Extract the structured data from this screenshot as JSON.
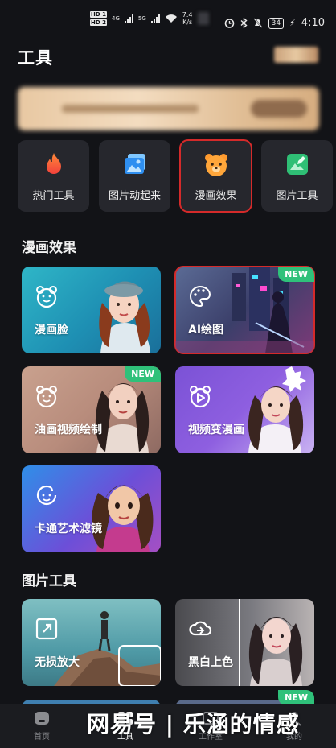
{
  "status_bar": {
    "hd1": "HD 1",
    "hd2": "HD 2",
    "net1": "4G",
    "net2": "5G",
    "speed": "7.4",
    "speed_unit": "K/s",
    "battery": "34",
    "time": "4:10"
  },
  "header": {
    "title": "工具"
  },
  "quick_tools": [
    {
      "label": "热门工具",
      "icon": "fire-icon"
    },
    {
      "label": "图片动起来",
      "icon": "image-gallery-icon"
    },
    {
      "label": "漫画效果",
      "icon": "bear-face-icon"
    },
    {
      "label": "图片工具",
      "icon": "image-edit-icon"
    }
  ],
  "comic_section": {
    "title": "漫画效果",
    "cards": [
      {
        "label": "漫画脸",
        "icon": "bear-icon",
        "badge": ""
      },
      {
        "label": "AI绘图",
        "icon": "palette-icon",
        "badge": "NEW"
      },
      {
        "label": "油画视频绘制",
        "icon": "bear-icon",
        "badge": "NEW"
      },
      {
        "label": "视频变漫画",
        "icon": "video-bear-icon",
        "badge": ""
      },
      {
        "label": "卡通艺术滤镜",
        "icon": "cartoon-face-icon",
        "badge": ""
      }
    ]
  },
  "image_tools_section": {
    "title": "图片工具",
    "cards": [
      {
        "label": "无损放大",
        "icon": "expand-icon",
        "badge": ""
      },
      {
        "label": "黑白上色",
        "icon": "color-cloud-icon",
        "badge": ""
      }
    ],
    "next_badge": "NEW"
  },
  "bottom_nav": [
    {
      "label": "首页",
      "icon": "home-icon"
    },
    {
      "label": "工具",
      "icon": "tools-icon"
    },
    {
      "label": "工作室",
      "icon": "studio-icon"
    },
    {
      "label": "我的",
      "icon": "profile-icon"
    }
  ],
  "watermark": "网易号 | 乐涵的情感",
  "colors": {
    "background": "#121317",
    "tile": "#26272d",
    "selection": "#d42a2a",
    "new_badge": "#2fc17a"
  }
}
